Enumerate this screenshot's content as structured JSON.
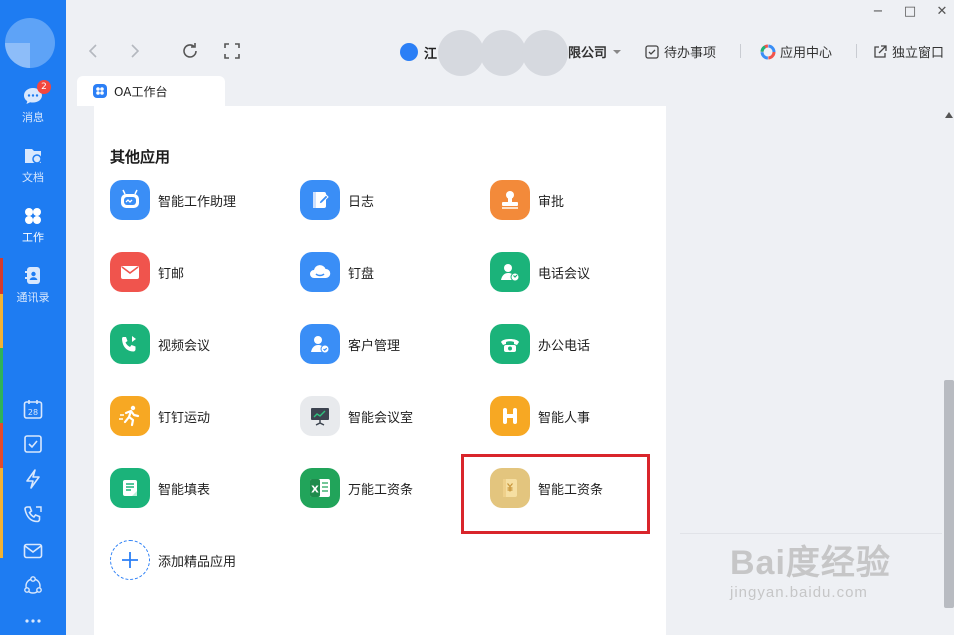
{
  "window": {
    "controls": {
      "minimize": "−",
      "maximize": "□",
      "close": "✕"
    }
  },
  "sidebar": {
    "message_badge": "2",
    "items": [
      {
        "label": "消息",
        "icon": "message-icon"
      },
      {
        "label": "文档",
        "icon": "document-icon"
      },
      {
        "label": "工作",
        "icon": "work-grid-icon"
      },
      {
        "label": "通讯录",
        "icon": "contacts-icon"
      }
    ],
    "bottom_icons": [
      "calendar-icon",
      "todo-check-icon",
      "flash-icon",
      "phone-icon",
      "mail-icon",
      "team-icon",
      "more-icon"
    ],
    "calendar_day": "28"
  },
  "toolbar": {
    "org_name_start": "江",
    "org_name_end": "限公司",
    "todo_label": "待办事项",
    "app_center_label": "应用中心",
    "standalone_label": "独立窗口"
  },
  "tab": {
    "label": "OA工作台"
  },
  "main": {
    "section_title": "其他应用",
    "apps": [
      {
        "label": "智能工作助理",
        "color": "#3a8ef6"
      },
      {
        "label": "日志",
        "color": "#3a8ef6"
      },
      {
        "label": "审批",
        "color": "#f38a3a"
      },
      {
        "label": "钉邮",
        "color": "#f0544d"
      },
      {
        "label": "钉盘",
        "color": "#3a8ef6"
      },
      {
        "label": "电话会议",
        "color": "#1bb37a"
      },
      {
        "label": "视频会议",
        "color": "#1bb37a"
      },
      {
        "label": "客户管理",
        "color": "#3a8ef6"
      },
      {
        "label": "办公电话",
        "color": "#1bb37a"
      },
      {
        "label": "钉钉运动",
        "color": "#f7a823"
      },
      {
        "label": "智能会议室",
        "color": "#e8eaed"
      },
      {
        "label": "智能人事",
        "color": "#f7a823"
      },
      {
        "label": "智能填表",
        "color": "#1bb37a"
      },
      {
        "label": "万能工资条",
        "color": "#21a45a"
      },
      {
        "label": "智能工资条",
        "color": "#e3c57e"
      }
    ],
    "add_app_label": "添加精品应用"
  },
  "watermark": {
    "main": "Bai度经验",
    "sub": "jingyan.baidu.com"
  }
}
